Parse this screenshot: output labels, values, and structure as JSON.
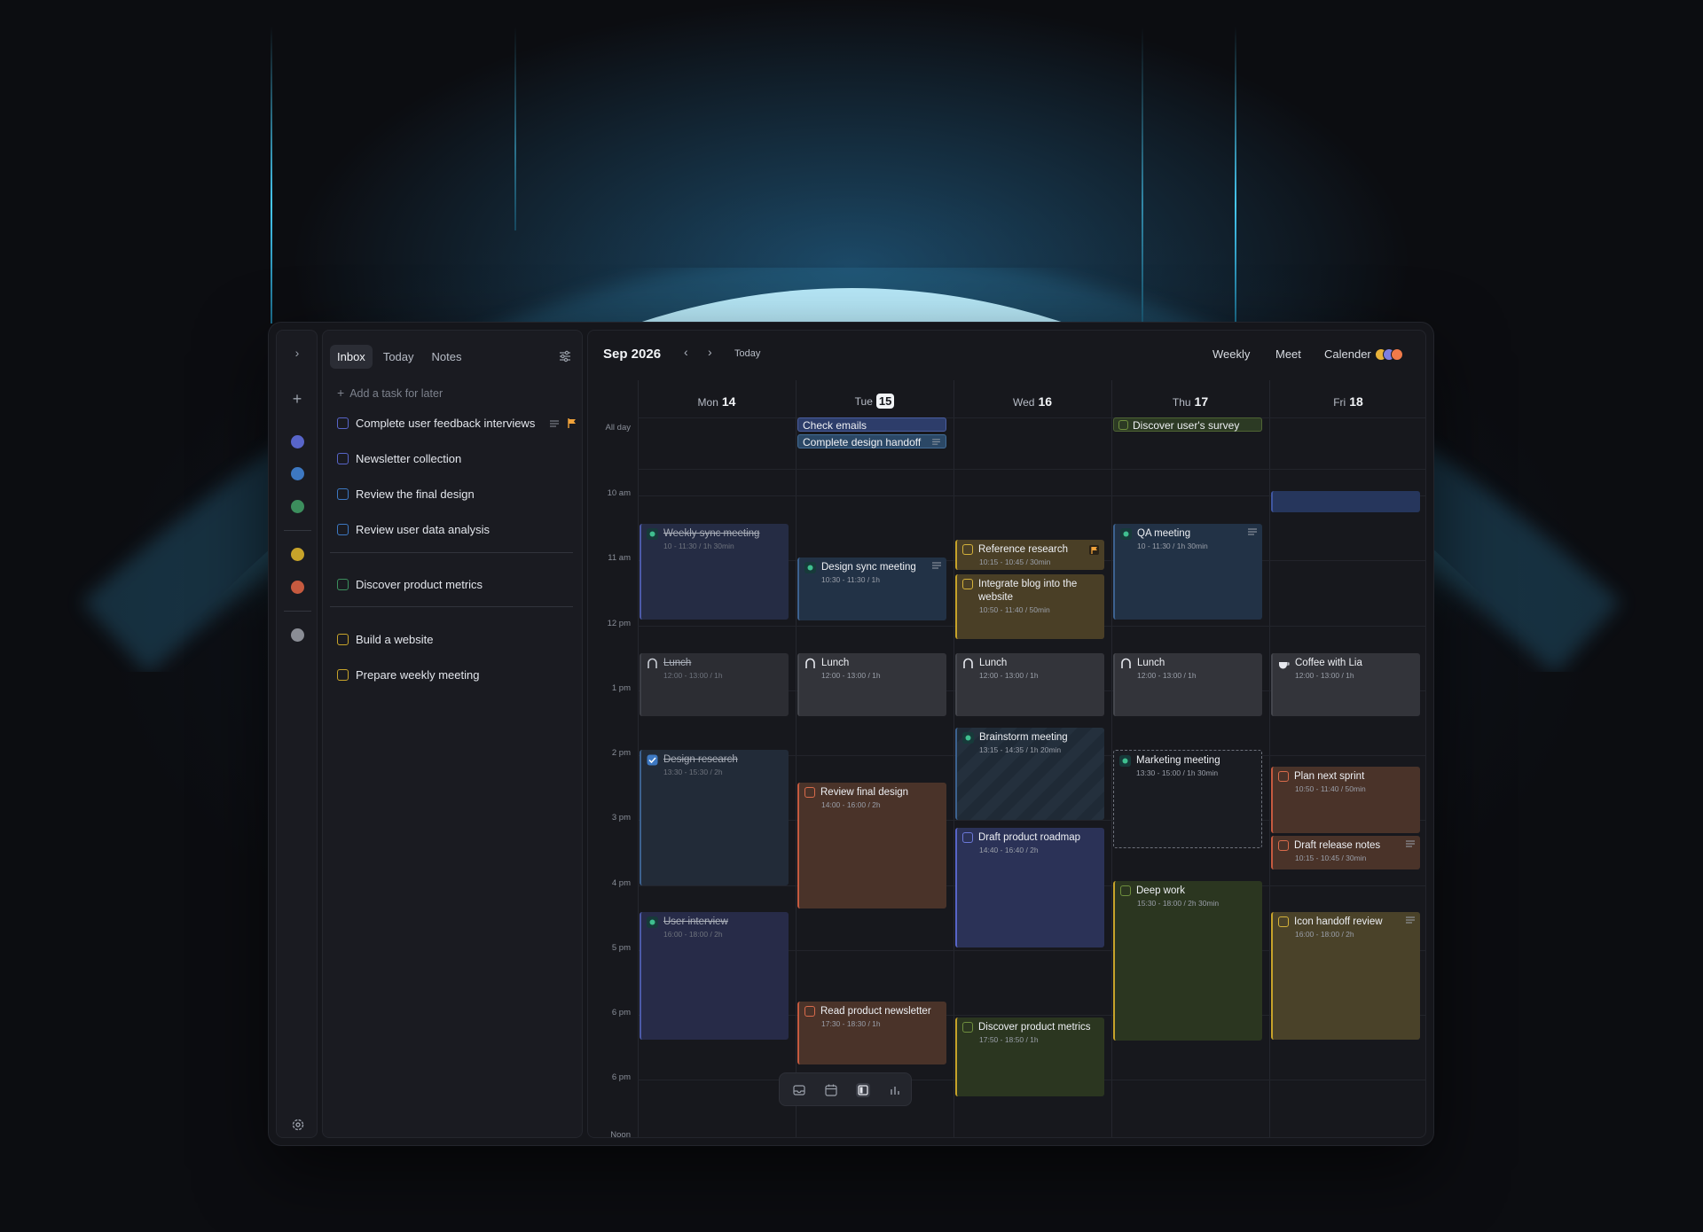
{
  "rail": {
    "expand_icon": "chevron-right-icon",
    "add_icon": "plus-icon",
    "settings_icon": "gear-icon",
    "colors": [
      "#5865c9",
      "#3d78c2",
      "#3c8e5d",
      "#c7a32a",
      "#c65a3f",
      "#8a8d95"
    ]
  },
  "panel": {
    "tabs": [
      "Inbox",
      "Today",
      "Notes"
    ],
    "active_tab": "Inbox",
    "add_task_placeholder": "Add a task for later",
    "tasks": [
      {
        "label": "Complete user feedback interviews",
        "color": "#5865c9"
      },
      {
        "label": "Newsletter collection",
        "color": "#5865c9"
      },
      {
        "label": "Review the final design",
        "color": "#3d78c2"
      },
      {
        "label": "Review user data analysis",
        "color": "#3d78c2"
      },
      {
        "label": "Discover product metrics",
        "color": "#3c8e5d"
      },
      {
        "label": "Build a website",
        "color": "#c7a32a"
      },
      {
        "label": "Prepare weekly meeting",
        "color": "#c7a32a"
      }
    ]
  },
  "calendar": {
    "month": "Sep 2026",
    "today_label": "Today",
    "view_weekly": "Weekly",
    "view_meet": "Meet",
    "view_calendar": "Calender",
    "days": [
      {
        "name": "Mon",
        "num": "14"
      },
      {
        "name": "Tue",
        "num": "15"
      },
      {
        "name": "Wed",
        "num": "16"
      },
      {
        "name": "Thu",
        "num": "17"
      },
      {
        "name": "Fri",
        "num": "18"
      }
    ],
    "all_day_label": "All day",
    "times": [
      "10 am",
      "11 am",
      "12 pm",
      "1 pm",
      "2 pm",
      "3 pm",
      "4 pm",
      "5 pm",
      "6 pm",
      "6 pm",
      "Noon"
    ],
    "all_day_events": [
      {
        "label": "Check emails"
      },
      {
        "label": "Complete design handoff"
      },
      {
        "label": "Discover user's survey"
      }
    ],
    "events": {
      "weekly_sync": {
        "title": "Weekly sync meeting",
        "sub": "10 - 11:30 / 1h 30min"
      },
      "lunch_mon": {
        "title": "Lunch",
        "sub": "12:00 - 13:00 / 1h"
      },
      "design_research": {
        "title": "Design research",
        "sub": "13:30 - 15:30 / 2h"
      },
      "user_interview": {
        "title": "User interview",
        "sub": "16:00 - 18:00 / 2h"
      },
      "design_sync": {
        "title": "Design sync meeting",
        "sub": "10:30 - 11:30 / 1h"
      },
      "lunch_tue": {
        "title": "Lunch",
        "sub": "12:00 - 13:00 / 1h"
      },
      "review_final": {
        "title": "Review final design",
        "sub": "14:00 - 16:00 / 2h"
      },
      "read_newsletter": {
        "title": "Read product newsletter",
        "sub": "17:30 - 18:30 / 1h"
      },
      "reference_research": {
        "title": "Reference research",
        "sub": "10:15 - 10:45 / 30min"
      },
      "integrate_blog": {
        "title": "Integrate blog into the website",
        "sub": "10:50 - 11:40 / 50min"
      },
      "lunch_wed": {
        "title": "Lunch",
        "sub": "12:00 - 13:00 / 1h"
      },
      "brainstorm": {
        "title": "Brainstorm meeting",
        "sub": "13:15 - 14:35 / 1h 20min"
      },
      "draft_roadmap": {
        "title": "Draft product roadmap",
        "sub": "14:40 - 16:40 / 2h"
      },
      "discover_metrics": {
        "title": "Discover product metrics",
        "sub": "17:50 - 18:50 / 1h"
      },
      "qa_meeting": {
        "title": "QA meeting",
        "sub": "10 - 11:30 / 1h 30min"
      },
      "lunch_thu": {
        "title": "Lunch",
        "sub": "12:00 - 13:00 / 1h"
      },
      "marketing": {
        "title": "Marketing meeting",
        "sub": "13:30 - 15:00 / 1h 30min"
      },
      "deep_work": {
        "title": "Deep work",
        "sub": "15:30 - 18:00 / 2h 30min"
      },
      "coffee_lia": {
        "title": "Coffee with Lia",
        "sub": "12:00 - 13:00 / 1h"
      },
      "plan_sprint": {
        "title": "Plan next sprint",
        "sub": "10:50 - 11:40 / 50min"
      },
      "draft_release": {
        "title": "Draft release notes",
        "sub": "10:15 - 10:45 / 30min"
      },
      "icon_handoff": {
        "title": "Icon handoff review",
        "sub": "16:00 - 18:00 / 2h"
      }
    },
    "dock_icons": [
      "inbox-icon",
      "calendar-icon",
      "layout-icon",
      "chart-icon"
    ]
  }
}
